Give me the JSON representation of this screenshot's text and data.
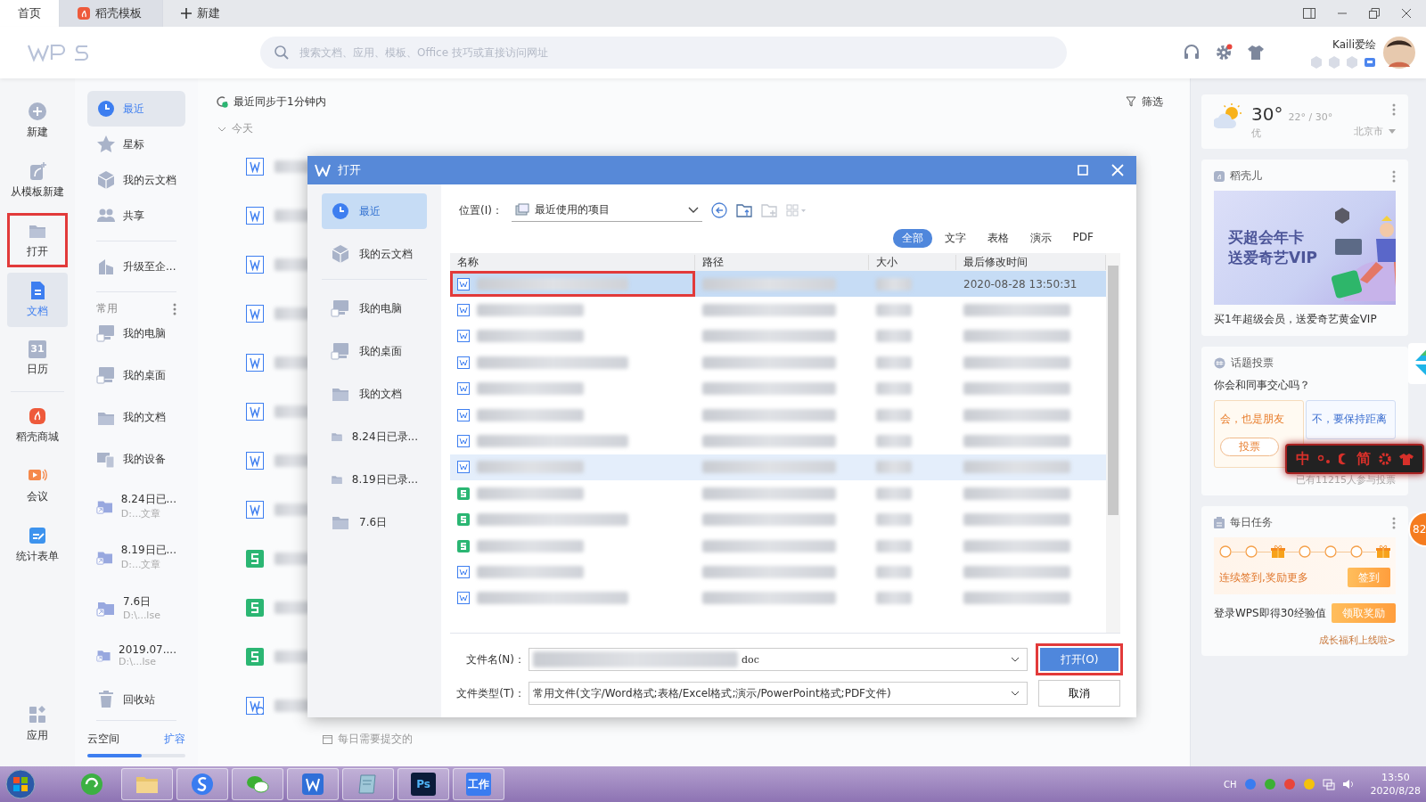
{
  "tabs": [
    {
      "label": "首页",
      "selected": true,
      "kind": "home"
    },
    {
      "label": "稻壳模板",
      "selected": false,
      "kind": "docer"
    },
    {
      "label": "新建",
      "selected": false,
      "kind": "new"
    }
  ],
  "header": {
    "search": {
      "placeholder": "搜索文档、应用、模板、Office 技巧或直接访问网址"
    },
    "user": {
      "name": "Kaili爱绘"
    },
    "settings_alert": true
  },
  "rail": [
    {
      "label": "新建",
      "kind": "plus",
      "selected": false,
      "outlined": false
    },
    {
      "label": "从模板新建",
      "kind": "template",
      "selected": false,
      "outlined": false
    },
    {
      "label": "打开",
      "kind": "folder",
      "selected": false,
      "outlined": true
    },
    {
      "label": "文档",
      "kind": "doc",
      "selected": true,
      "outlined": false
    },
    {
      "label": "日历",
      "kind": "calendar",
      "icon_text": "31",
      "selected": false,
      "outlined": false
    },
    {
      "label": "稻壳商城",
      "kind": "docer",
      "selected": false,
      "outlined": false
    },
    {
      "label": "会议",
      "kind": "meeting",
      "selected": false,
      "outlined": false
    },
    {
      "label": "统计表单",
      "kind": "form",
      "selected": false,
      "outlined": false
    },
    {
      "label": "应用",
      "kind": "apps",
      "selected": false,
      "outlined": false
    }
  ],
  "nav": {
    "items": [
      {
        "label": "最近",
        "kind": "clock",
        "selected": true
      },
      {
        "label": "星标",
        "kind": "star",
        "selected": false
      },
      {
        "label": "我的云文档",
        "kind": "cube",
        "selected": false
      },
      {
        "label": "共享",
        "kind": "people",
        "selected": false
      }
    ],
    "upgrade": "升级至企...",
    "common_title": "常用",
    "common": [
      {
        "label": "我的电脑",
        "kind": "pc"
      },
      {
        "label": "我的桌面",
        "kind": "desktop"
      },
      {
        "label": "我的文档",
        "kind": "folder"
      },
      {
        "label": "我的设备",
        "kind": "device"
      },
      {
        "label": "8.24日已...",
        "path": "D:...文章",
        "kind": "folder"
      },
      {
        "label": "8.19日已...",
        "path": "D:...文章",
        "kind": "folder"
      },
      {
        "label": "7.6日",
        "path": "D:\\...lse",
        "kind": "folder"
      },
      {
        "label": "2019.07....",
        "path": "D:\\...lse",
        "kind": "folder"
      }
    ],
    "recycle": "回收站",
    "cloud": {
      "label": "云空间",
      "action": "扩容",
      "level": 0.55
    }
  },
  "main": {
    "sync": "最近同步于1分钟内",
    "filter": "筛选",
    "group": "今天",
    "files": [
      {
        "kind": "writer"
      },
      {
        "kind": "writer"
      },
      {
        "kind": "writer"
      },
      {
        "kind": "writer"
      },
      {
        "kind": "writer"
      },
      {
        "kind": "writer"
      },
      {
        "kind": "writer"
      },
      {
        "kind": "writer"
      },
      {
        "kind": "sheet"
      },
      {
        "kind": "sheet"
      },
      {
        "kind": "sheet"
      },
      {
        "kind": "writer-shared"
      }
    ],
    "footer_note": "每日需要提交的"
  },
  "dialog": {
    "title": "打开",
    "places": [
      {
        "label": "最近",
        "kind": "clock",
        "selected": true
      },
      {
        "label": "我的云文档",
        "kind": "cube",
        "selected": false
      },
      {
        "label": "我的电脑",
        "kind": "pc",
        "selected": false
      },
      {
        "label": "我的桌面",
        "kind": "desktop",
        "selected": false
      },
      {
        "label": "我的文档",
        "kind": "folder",
        "selected": false
      },
      {
        "label": "8.24日已录...",
        "kind": "folder",
        "selected": false
      },
      {
        "label": "8.19日已录...",
        "kind": "folder",
        "selected": false
      },
      {
        "label": "7.6日",
        "kind": "folder",
        "selected": false
      }
    ],
    "location_label": "位置(I)：",
    "location": "最近使用的项目",
    "filters": [
      {
        "label": "全部",
        "selected": true
      },
      {
        "label": "文字",
        "selected": false
      },
      {
        "label": "表格",
        "selected": false
      },
      {
        "label": "演示",
        "selected": false
      },
      {
        "label": "PDF",
        "selected": false
      }
    ],
    "columns": [
      "名称",
      "路径",
      "大小",
      "最后修改时间"
    ],
    "rows": [
      {
        "kind": "writer",
        "selected": true,
        "hovered": false,
        "modified": "2020-08-28 13:50:31"
      },
      {
        "kind": "writer",
        "selected": false,
        "hovered": false
      },
      {
        "kind": "writer",
        "selected": false,
        "hovered": false
      },
      {
        "kind": "writer",
        "selected": false,
        "hovered": false
      },
      {
        "kind": "writer",
        "selected": false,
        "hovered": false
      },
      {
        "kind": "writer",
        "selected": false,
        "hovered": false
      },
      {
        "kind": "writer",
        "selected": false,
        "hovered": false
      },
      {
        "kind": "writer",
        "selected": false,
        "hovered": true
      },
      {
        "kind": "sheet",
        "selected": false,
        "hovered": false
      },
      {
        "kind": "sheet",
        "selected": false,
        "hovered": false
      },
      {
        "kind": "sheet",
        "selected": false,
        "hovered": false
      },
      {
        "kind": "writer",
        "selected": false,
        "hovered": false
      },
      {
        "kind": "writer",
        "selected": false,
        "hovered": false
      }
    ],
    "filename_label": "文件名(N)：",
    "filename_suffix": "doc",
    "filetype_label": "文件类型(T)：",
    "filetype": "常用文件(文字/Word格式;表格/Excel格式;演示/PowerPoint格式;PDF文件)",
    "open_button": "打开(O)",
    "cancel_button": "取消"
  },
  "right": {
    "weather": {
      "temp": "30°",
      "range": "22° / 30°",
      "quality": "优",
      "city": "北京市"
    },
    "docer": {
      "title": "稻壳儿",
      "banner_lines": [
        "买超会年卡",
        "送爱奇艺VIP"
      ],
      "caption": "买1年超级会员，送爱奇艺黄金VIP"
    },
    "vote": {
      "title": "话题投票",
      "question": "你会和同事交心吗？",
      "option_a": "会，也是朋友",
      "option_b": "不，要保持距离",
      "vote_button": "投票",
      "count": "已有11215人参与投票"
    },
    "tasks": {
      "title": "每日任务",
      "steps": [
        {
          "kind": "dot"
        },
        {
          "kind": "dot"
        },
        {
          "kind": "gift"
        },
        {
          "kind": "dot"
        },
        {
          "kind": "dot"
        },
        {
          "kind": "dot"
        },
        {
          "kind": "gift"
        }
      ],
      "streak": "连续签到,奖励更多",
      "checkin": "签到",
      "login_task": "登录WPS即得30经验值",
      "claim": "领取奖励",
      "more": "成长福利上线啦>"
    }
  },
  "ime": {
    "mode": "中",
    "script": "简"
  },
  "float_badge": "82",
  "taskbar": {
    "apps": [
      {
        "kind": "browser"
      },
      {
        "kind": "explorer"
      },
      {
        "kind": "sogou"
      },
      {
        "kind": "wechat"
      },
      {
        "kind": "wps"
      },
      {
        "kind": "notepad"
      },
      {
        "kind": "ps",
        "text": "Ps"
      },
      {
        "kind": "work",
        "text": "工作"
      }
    ],
    "lang": "CH",
    "time": "13:50",
    "date": "2020/8/28"
  }
}
